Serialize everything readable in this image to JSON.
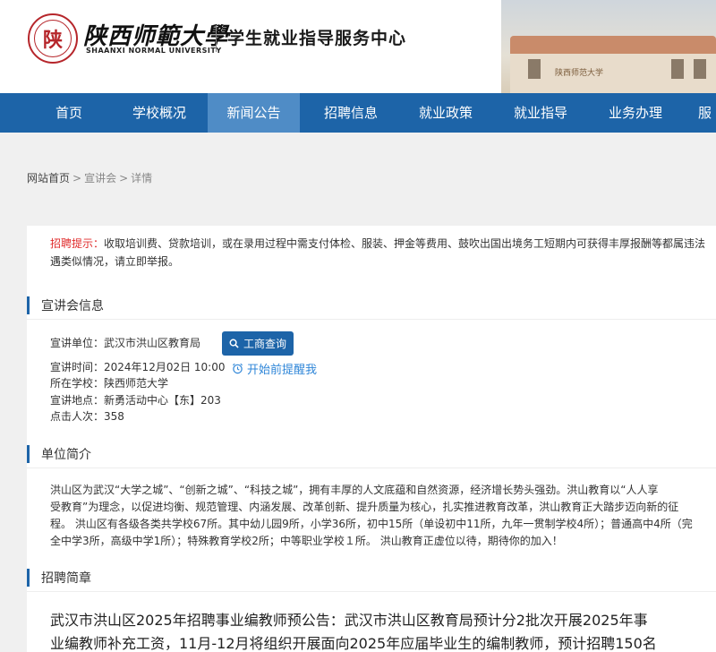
{
  "header": {
    "logo_seal_char": "陕",
    "university_cn": "陕西师範大學",
    "university_en": "SHAANXI NORMAL UNIVERSITY",
    "center_name": "学生就业指导服务中心",
    "campus_sign": "陕西师范大学"
  },
  "nav": {
    "items": [
      "首页",
      "学校概况",
      "新闻公告",
      "招聘信息",
      "就业政策",
      "就业指导",
      "业务办理",
      "服"
    ],
    "active_index": 2
  },
  "breadcrumb": {
    "home": "网站首页",
    "sep1": ">",
    "section": "宣讲会",
    "sep2": ">",
    "current": "详情"
  },
  "tip": {
    "label": "招聘提示：",
    "text1": "收取培训费、贷款培训，或在录用过程中需支付体检、服装、押金等费用、鼓吹出国出境务工短期内可获得丰厚报酬等都属违法",
    "text2": "遇类似情况，请立即举报。"
  },
  "info_section": {
    "title": "宣讲会信息",
    "unit_label": "宣讲单位：",
    "unit_value": "武汉市洪山区教育局",
    "biz_button": "工商查询",
    "time_label": "宣讲时间：",
    "time_value": "2024年12月02日 10:00",
    "remind_label": "开始前提醒我",
    "school_label": "所在学校：",
    "school_value": "陕西师范大学",
    "place_label": "宣讲地点：",
    "place_value": "新勇活动中心【东】203",
    "views_label": "点击人次：",
    "views_value": "358"
  },
  "intro_section": {
    "title": "单位简介",
    "line1": "洪山区为武汉“大学之城”、“创新之城”、“科技之城”，拥有丰厚的人文底蕴和自然资源，经济增长势头强劲。洪山教育以“人人享",
    "line2": "受教育”为理念，以促进均衡、规范管理、内涵发展、改革创新、提升质量为核心，扎实推进教育改革，洪山教育正大踏步迈向新的征",
    "line3": "程。 洪山区有各级各类共学校67所。其中幼儿园9所，小学36所，初中15所（单设初中11所，九年一贯制学校4所）；普通高中4所（完",
    "line4": "全中学3所，高级中学1所）；特殊教育学校2所；中等职业学校１所。 洪山教育正虚位以待，期待你的加入！"
  },
  "recruit_section": {
    "title": "招聘简章",
    "line1": "武汉市洪山区2025年招聘事业编教师预公告：武汉市洪山区教育局预计分2批次开展2025年事",
    "line2": "业编教师补充工资，11月-12月将组织开展面向2025年应届毕业生的编制教师，预计招聘150名"
  },
  "colors": {
    "nav_bg": "#1d64a8",
    "nav_active": "#4f8cc6",
    "tip_label": "#e02b2b",
    "remind_link": "#2f86d8",
    "seal": "#b6262b"
  }
}
